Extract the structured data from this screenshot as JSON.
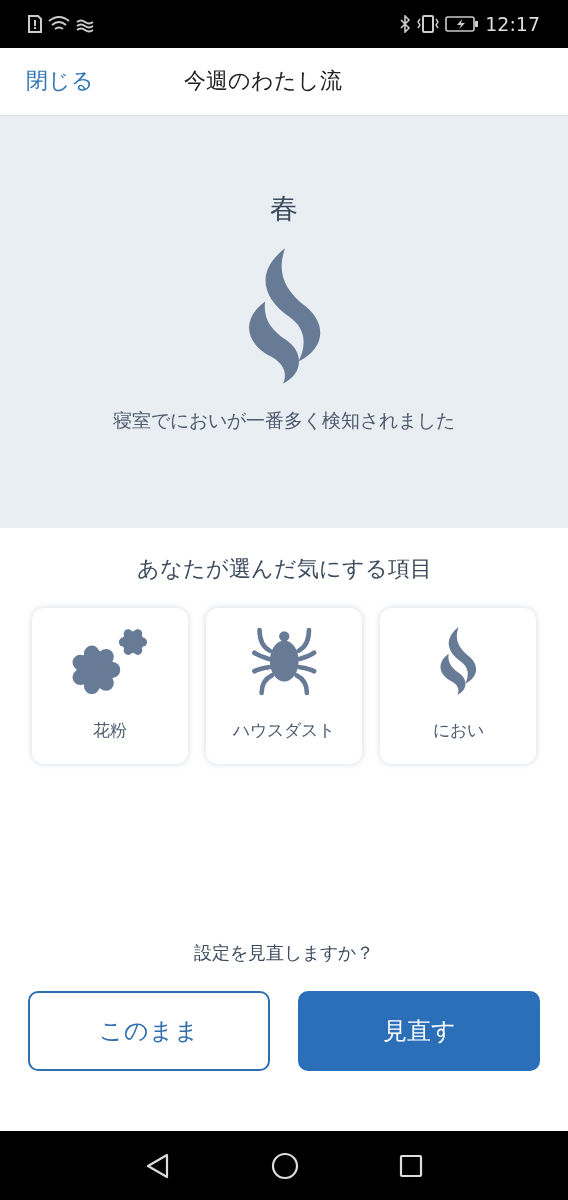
{
  "status_bar": {
    "time": "12:17"
  },
  "header": {
    "close": "閉じる",
    "title": "今週のわたし流"
  },
  "hero": {
    "season": "春",
    "kind": "odor",
    "message": "寝室でにおいが一番多く検知されました"
  },
  "selected_items": {
    "title": "あなたが選んだ気にする項目",
    "items": [
      {
        "label": "花粉",
        "kind": "pollen"
      },
      {
        "label": "ハウスダスト",
        "kind": "mite"
      },
      {
        "label": "におい",
        "kind": "odor"
      }
    ]
  },
  "footer": {
    "question": "設定を見直しますか？",
    "buttons": [
      {
        "label": "このまま",
        "kind": "secondary"
      },
      {
        "label": "見直す",
        "kind": "primary"
      }
    ]
  }
}
